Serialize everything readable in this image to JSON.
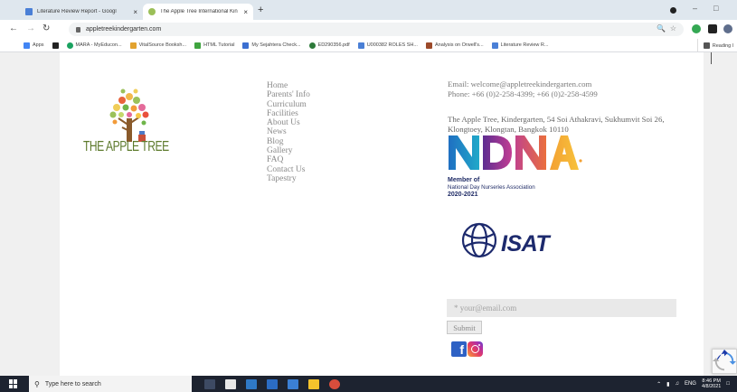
{
  "browser": {
    "tabs": [
      {
        "title": "Literature Review Report - Googl",
        "close": "×"
      },
      {
        "title": "The Apple Tree International Kin",
        "close": "×"
      }
    ],
    "new_tab": "+",
    "url": "appletreekindergarten.com",
    "bookmarks": [
      "Apps",
      "MARA - MyEducon...",
      "VitalSource Booksh...",
      "HTML Tutorial",
      "My Sejahtera Check...",
      "ED290356.pdf",
      "U000382 ROLES SH...",
      "Analysis on Orwell's...",
      "Literature Review R..."
    ],
    "reading_list": "Reading l"
  },
  "site": {
    "logo_text": "THE APPLE TREE",
    "menu": [
      "Home",
      "Parents' Info",
      "Curriculum",
      "Facilities",
      "About Us",
      "News",
      "Blog",
      "Gallery",
      "FAQ",
      "Contact Us",
      "Tapestry"
    ],
    "contact": {
      "email": "Email: welcome@appletreekindergarten.com",
      "phone": "Phone: +66 (0)2-258-4399; +66 (0)2-258-4599"
    },
    "address": "The Apple Tree, Kindergarten, 54 Soi Athakravi, Sukhumvit Soi 26, Klongtoey, Klongtan, Bangkok 10110",
    "ndna": {
      "logo_text": "NDNA",
      "member": "Member of",
      "association": "National Day Nurseries Association",
      "years": "2020-2021"
    },
    "isat": "ISAT",
    "newsletter": {
      "placeholder": "* your@email.com",
      "submit": "Submit"
    }
  },
  "taskbar": {
    "search_placeholder": "Type here to search",
    "lang": "ENG",
    "time": "8:46 PM",
    "date": "4/8/2021"
  },
  "colors": {
    "logo_green": "#5d7a2c",
    "menu_gray": "#8a8a8a",
    "isat_navy": "#1d2a6d",
    "facebook": "#2e61c4"
  }
}
